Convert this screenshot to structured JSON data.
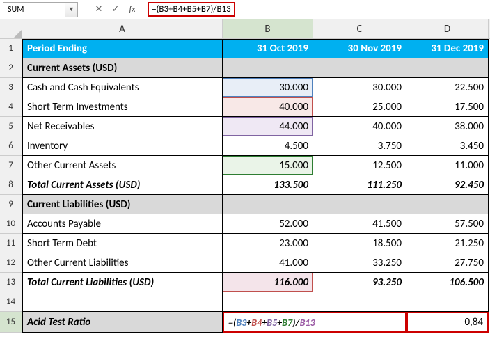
{
  "nameBox": "SUM",
  "formulaBar": "=(B3+B4+B5+B7)/B13",
  "columns": [
    "A",
    "B",
    "C",
    "D"
  ],
  "rows": [
    "1",
    "2",
    "3",
    "4",
    "5",
    "6",
    "7",
    "8",
    "9",
    "10",
    "11",
    "12",
    "13",
    "14",
    "15"
  ],
  "grid": {
    "r1": {
      "a": "Period Ending",
      "b": "31 Oct 2019",
      "c": "30 Nov 2019",
      "d": "31 Dec  2019"
    },
    "r2": {
      "a": "Current Assets (USD)",
      "b": "",
      "c": "",
      "d": ""
    },
    "r3": {
      "a": "Cash and Cash Equivalents",
      "b": "30.000",
      "c": "30.000",
      "d": "22.500"
    },
    "r4": {
      "a": "Short Term Investments",
      "b": "40.000",
      "c": "25.000",
      "d": "17.500"
    },
    "r5": {
      "a": "Net Receivables",
      "b": "44.000",
      "c": "40.000",
      "d": "38.000"
    },
    "r6": {
      "a": "Inventory",
      "b": "4.500",
      "c": "3.750",
      "d": "3.450"
    },
    "r7": {
      "a": "Other Current Assets",
      "b": "15.000",
      "c": "12.500",
      "d": "11.000"
    },
    "r8": {
      "a": "Total Current Assets (USD)",
      "b": "133.500",
      "c": "111.250",
      "d": "92.450"
    },
    "r9": {
      "a": "Current Liabilities (USD)",
      "b": "",
      "c": "",
      "d": ""
    },
    "r10": {
      "a": "Accounts Payable",
      "b": "52.000",
      "c": "41.500",
      "d": "57.500"
    },
    "r11": {
      "a": "Short Term Debt",
      "b": "23.000",
      "c": "18.500",
      "d": "21.250"
    },
    "r12": {
      "a": "Other Current Liabilities",
      "b": "41.000",
      "c": "33.250",
      "d": "27.750"
    },
    "r13": {
      "a": "Total Current Liabilities (USD)",
      "b": "116.000",
      "c": "93.250",
      "d": "106.500"
    },
    "r14": {
      "a": "",
      "b": "",
      "c": "",
      "d": ""
    },
    "r15": {
      "a": "Acid Test Ratio",
      "c": "",
      "d": "0,84"
    }
  },
  "editFormula": {
    "prefix": "=( ",
    "b3": "B3",
    "p1": " + ",
    "b4": "B4",
    "p2": " + ",
    "b5": "B5",
    "p3": " + ",
    "b7": "B7",
    "p4": " )/ ",
    "b13": "B13"
  },
  "chart_data": {
    "type": "table",
    "title": "Acid Test Ratio worksheet",
    "categories": [
      "31 Oct 2019",
      "30 Nov 2019",
      "31 Dec 2019"
    ],
    "series": [
      {
        "name": "Cash and Cash Equivalents",
        "values": [
          30.0,
          30.0,
          22.5
        ]
      },
      {
        "name": "Short Term Investments",
        "values": [
          40.0,
          25.0,
          17.5
        ]
      },
      {
        "name": "Net Receivables",
        "values": [
          44.0,
          40.0,
          38.0
        ]
      },
      {
        "name": "Inventory",
        "values": [
          4.5,
          3.75,
          3.45
        ]
      },
      {
        "name": "Other Current Assets",
        "values": [
          15.0,
          12.5,
          11.0
        ]
      },
      {
        "name": "Total Current Assets (USD)",
        "values": [
          133.5,
          111.25,
          92.45
        ]
      },
      {
        "name": "Accounts Payable",
        "values": [
          52.0,
          41.5,
          57.5
        ]
      },
      {
        "name": "Short Term Debt",
        "values": [
          23.0,
          18.5,
          21.25
        ]
      },
      {
        "name": "Other Current Liabilities",
        "values": [
          41.0,
          33.25,
          27.75
        ]
      },
      {
        "name": "Total Current Liabilities (USD)",
        "values": [
          116.0,
          93.25,
          106.5
        ]
      },
      {
        "name": "Acid Test Ratio",
        "values": [
          null,
          null,
          0.84
        ]
      }
    ]
  }
}
